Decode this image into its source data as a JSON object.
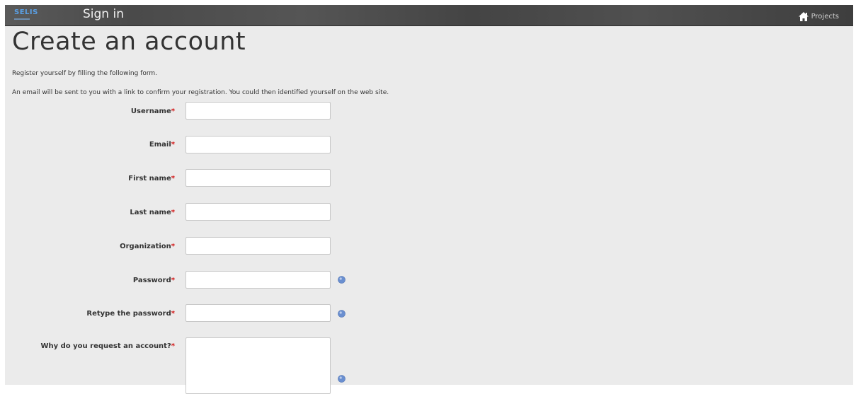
{
  "header": {
    "logo": "SELIS",
    "title": "Sign in",
    "projects_link": "Projects"
  },
  "main": {
    "heading": "Create an account",
    "intro_line1": "Register yourself by filling the following form.",
    "intro_line2": "An email will be sent to you with a link to confirm your registration. You could then identified yourself on the web site."
  },
  "form": {
    "required_marker": "*",
    "fields": [
      {
        "label": "Username",
        "value": ""
      },
      {
        "label": "Email",
        "value": ""
      },
      {
        "label": "First name",
        "value": ""
      },
      {
        "label": "Last name",
        "value": ""
      },
      {
        "label": "Organization",
        "value": ""
      },
      {
        "label": "Password",
        "value": ""
      },
      {
        "label": "Retype the password",
        "value": ""
      },
      {
        "label": "Why do you request an account?",
        "value": ""
      }
    ]
  },
  "colors": {
    "required": "#d21414",
    "topbar": "#4a4a4a",
    "help_icon": "#6a8fd0"
  },
  "icons": {
    "home": "home-icon",
    "help": "help-icon"
  }
}
